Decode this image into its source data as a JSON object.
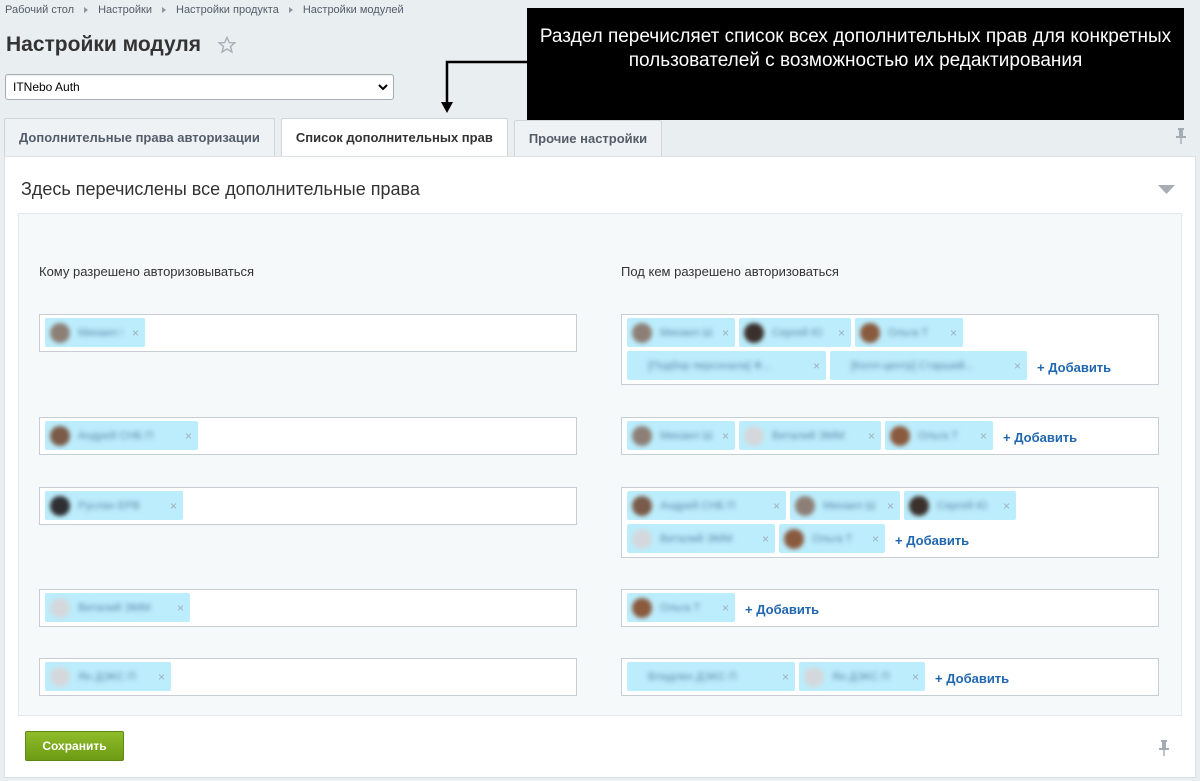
{
  "breadcrumb": [
    "Рабочий стол",
    "Настройки",
    "Настройки продукта",
    "Настройки модулей"
  ],
  "page_title": "Настройки модуля",
  "module_select": {
    "value": "ITNebo Auth"
  },
  "tabs": [
    {
      "label": "Дополнительные права авторизации",
      "active": false
    },
    {
      "label": "Список дополнительных прав",
      "active": true
    },
    {
      "label": "Прочие настройки",
      "active": false
    }
  ],
  "callout": {
    "text": "Раздел перечисляет список всех дополнительных прав для конкретных пользователей с возможностью их редактирования"
  },
  "section": {
    "title": "Здесь перечислены все дополнительные права",
    "left_header": "Кому разрешено авторизовываться",
    "right_header": "Под кем разрешено авторизоваться"
  },
  "add_label": "+ Добавить",
  "save_label": "Сохранить",
  "rows": [
    {
      "left": [
        {
          "name": "Михаил Ш",
          "avatar": "#8d7f76"
        }
      ],
      "right": [
        {
          "name": "Михаил Ш",
          "avatar": "#8d7f76"
        },
        {
          "name": "Сергей Ю",
          "avatar": "#3a302c"
        },
        {
          "name": "Ольга Т",
          "avatar": "#8a5a3e"
        },
        {
          "name": "[Подбор персонала] Ф...",
          "avatar": ""
        },
        {
          "name": "[Колл-центр] Старший...",
          "avatar": ""
        }
      ]
    },
    {
      "left": [
        {
          "name": "Андрей СНБ П",
          "avatar": "#7a5a48"
        }
      ],
      "right": [
        {
          "name": "Михаил Ш",
          "avatar": "#8d7f76"
        },
        {
          "name": "Виталий ЭММ",
          "avatar": "#d4d8dc"
        },
        {
          "name": "Ольга Т",
          "avatar": "#8a5a3e"
        }
      ]
    },
    {
      "left": [
        {
          "name": "Руслан ЕРВ",
          "avatar": "#2f2f33"
        }
      ],
      "right": [
        {
          "name": "Андрей СНБ П",
          "avatar": "#7a5a48"
        },
        {
          "name": "Михаил Ш",
          "avatar": "#8d7f76"
        },
        {
          "name": "Сергей Ю",
          "avatar": "#3a302c"
        },
        {
          "name": "Виталий ЭММ",
          "avatar": "#d4d8dc"
        },
        {
          "name": "Ольга Т",
          "avatar": "#8a5a3e"
        }
      ]
    },
    {
      "left": [
        {
          "name": "Виталий ЭММ",
          "avatar": "#d4d8dc"
        }
      ],
      "right": [
        {
          "name": "Ольга Т",
          "avatar": "#8a5a3e"
        }
      ]
    },
    {
      "left": [
        {
          "name": "Ян ДЭКС П",
          "avatar": "#d4d8dc"
        }
      ],
      "right": [
        {
          "name": "Владлен ДЭКС П",
          "avatar": ""
        },
        {
          "name": "Ян ДЭКС П",
          "avatar": "#d4d8dc"
        }
      ]
    }
  ]
}
